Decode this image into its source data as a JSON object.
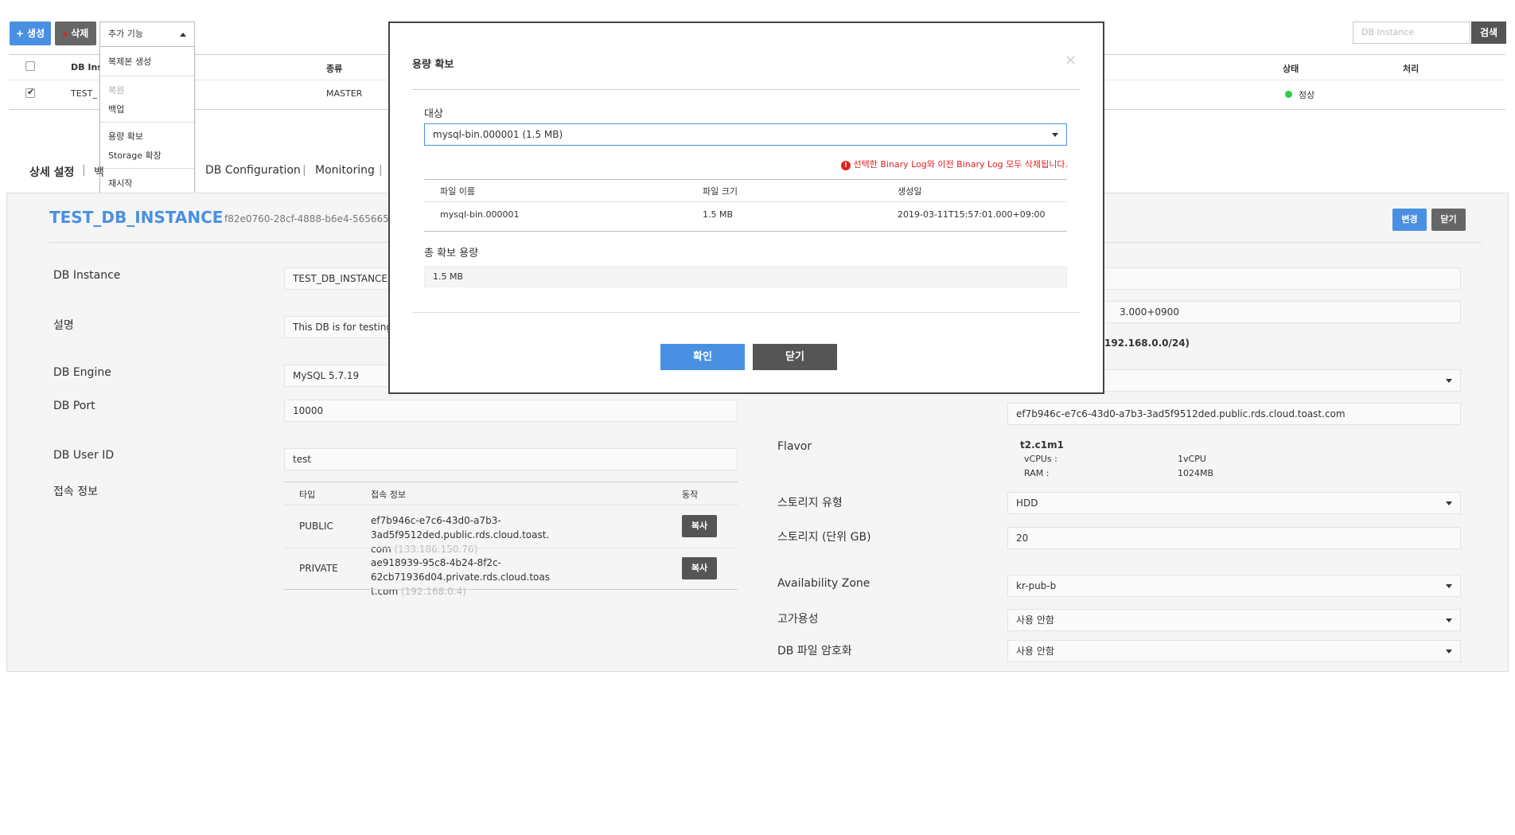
{
  "toolbar": {
    "create_label": "+ 생성",
    "delete_label": "삭제",
    "delete_mark": "x",
    "more_label": "추가 기능",
    "more_menu": [
      "복제본 생성",
      "복원",
      "백업",
      "용량 확보",
      "Storage 확장",
      "재시작"
    ],
    "search_placeholder": "DB Instance",
    "search_label": "검색"
  },
  "instance_table": {
    "headers": [
      "DB Ins",
      "종류",
      "상태",
      "처리"
    ],
    "row": {
      "name": "TEST_",
      "type": "MASTER",
      "status": "정상",
      "status_color": "#2ecc40"
    }
  },
  "tabs": [
    "상세 설정",
    "백",
    "DB Configuration",
    "Monitoring"
  ],
  "detail": {
    "title": "TEST_DB_INSTANCE",
    "id": "f82e0760-28cf-4888-b6e4-5656650",
    "edit_label": "변경",
    "close_label": "닫기",
    "left": {
      "db_instance_label": "DB Instance",
      "db_instance_value": "TEST_DB_INSTANCE",
      "desc_label": "설명",
      "desc_value": "This DB is for testing",
      "engine_label": "DB Engine",
      "engine_value": "MySQL 5.7.19",
      "port_label": "DB Port",
      "port_value": "10000",
      "user_label": "DB User ID",
      "user_value": "test",
      "conn_label": "접속 정보",
      "conn_headers": [
        "타입",
        "접속 정보",
        "동작"
      ],
      "conn_rows": [
        {
          "type": "PUBLIC",
          "host1": "ef7b946c-e7c6-43d0-a7b3-3ad5f9512ded.public.rds.cloud.toast.",
          "host2": "com",
          "ip": "(133.186.150.76)",
          "action": "복사"
        },
        {
          "type": "PRIVATE",
          "host1": "ae918939-95c8-4b24-8f2c-62cb71936d04.private.rds.cloud.toas",
          "host2": "t.com",
          "ip": "(192.168.0.4)",
          "action": "복사"
        }
      ]
    },
    "right": {
      "created_partial": "3.000+0900",
      "subnet_partial": "192.168.0.0/24)",
      "domain_value": "ef7b946c-e7c6-43d0-a7b3-3ad5f9512ded.public.rds.cloud.toast.com",
      "flavor_label": "Flavor",
      "flavor_name": "t2.c1m1",
      "flavor_vcpu_label": "vCPUs :",
      "flavor_vcpu_value": "1vCPU",
      "flavor_ram_label": "RAM :",
      "flavor_ram_value": "1024MB",
      "storage_type_label": "스토리지 유형",
      "storage_type_value": "HDD",
      "storage_size_label": "스토리지 (단위 GB)",
      "storage_size_value": "20",
      "az_label": "Availability Zone",
      "az_value": "kr-pub-b",
      "ha_label": "고가용성",
      "ha_value": "사용 안함",
      "enc_label": "DB 파일 암호화",
      "enc_value": "사용 안함"
    }
  },
  "modal": {
    "title": "용량 확보",
    "close_icon": "×",
    "target_label": "대상",
    "target_value": "mysql-bin.000001 (1.5 MB)",
    "warning": "선택한 Binary Log와 이전 Binary Log 모두 삭제됩니다.",
    "warning_color": "#e02020",
    "headers": [
      "파일 이름",
      "파일 크기",
      "생성일"
    ],
    "rows": [
      {
        "name": "mysql-bin.000001",
        "size": "1.5 MB",
        "date": "2019-03-11T15:57:01.000+09:00"
      }
    ],
    "total_label": "총 확보 용량",
    "total_value": "1.5 MB",
    "confirm_label": "확인",
    "cancel_label": "닫기"
  }
}
